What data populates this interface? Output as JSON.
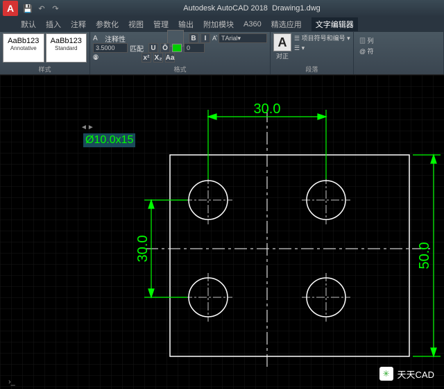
{
  "app": {
    "title": "Autodesk AutoCAD 2018",
    "doc": "Drawing1.dwg",
    "logo": "A"
  },
  "qat": {
    "save": "💾",
    "undo": "↶",
    "redo": "↷"
  },
  "menu": {
    "items": [
      "默认",
      "插入",
      "注释",
      "参数化",
      "视图",
      "管理",
      "输出",
      "附加模块",
      "A360",
      "精选应用",
      "文字编辑器"
    ],
    "active_index": 10
  },
  "ribbon": {
    "style": {
      "label": "样式",
      "swatch1": {
        "sample": "AaBb123",
        "name": "Annotative"
      },
      "swatch2": {
        "sample": "AaBb123",
        "name": "Standard"
      }
    },
    "format": {
      "label": "格式",
      "annotative": "注释性",
      "height_value": "3.5000",
      "match_label": "匹配",
      "font": "Arial",
      "layer": "0",
      "color_swatch": "#00cc00",
      "bold": "B",
      "italic": "I",
      "underline": "U",
      "overline": "Ō",
      "strike": "A",
      "sup": "x²",
      "sub": "X₂",
      "clear": "Aa"
    },
    "para": {
      "label": "段落",
      "align_label": "对正",
      "big_a": "A",
      "bullets": "项目符号和编号"
    }
  },
  "drawing": {
    "dim_top": "30.0",
    "dim_left": "30.0",
    "dim_right": "50.0",
    "edit_text": "Ø10.0x15"
  },
  "watermark": {
    "text": "天天CAD"
  },
  "cmd": {
    "caret": "›_"
  }
}
